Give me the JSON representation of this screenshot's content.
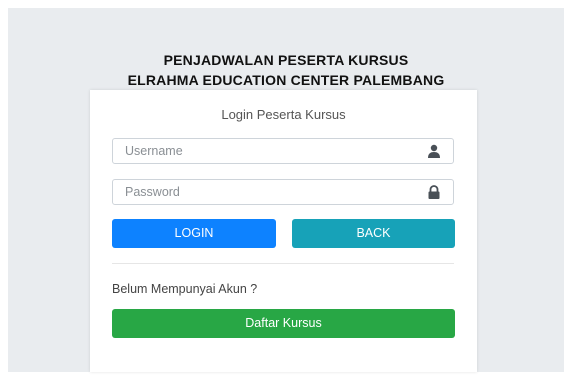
{
  "header": {
    "line1": "PENJADWALAN PESERTA KURSUS",
    "line2": "ELRAHMA EDUCATION CENTER PALEMBANG"
  },
  "card": {
    "heading": "Login Peserta Kursus",
    "username_placeholder": "Username",
    "password_placeholder": "Password",
    "login_label": "LOGIN",
    "back_label": "BACK",
    "question": "Belum Mempunyai Akun ?",
    "register_label": "Daftar Kursus"
  },
  "icons": {
    "username": "user-icon",
    "password": "lock-icon"
  },
  "colors": {
    "login": "#0d82ff",
    "back": "#17a2b8",
    "register": "#28a745",
    "background": "#e9ecef"
  }
}
